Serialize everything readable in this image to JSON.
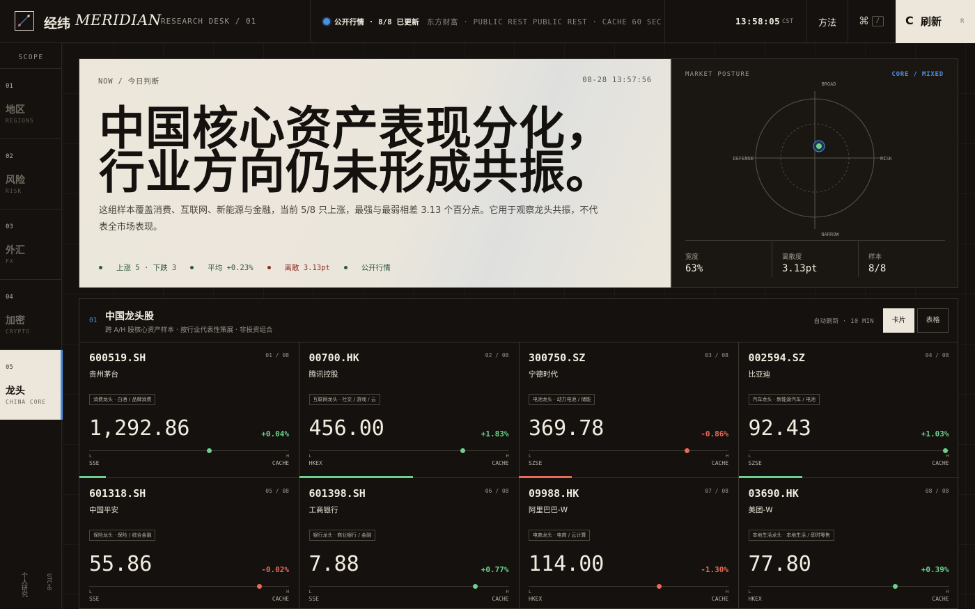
{
  "header": {
    "logo_cn": "经纬",
    "logo_en": "MERIDIAN",
    "desk": "RESEARCH DESK / 01",
    "status": "公开行情 · 8/8 已更新",
    "source": "东方财富 · PUBLIC REST  PUBLIC REST · CACHE 60 SEC",
    "clock": "13:58:05",
    "timezone": "CST",
    "method_label": "方法",
    "cmd_symbol": "⌘",
    "cmd_key": "/",
    "refresh_icon": "C",
    "refresh_label": "刷新",
    "refresh_key": "R"
  },
  "sidebar": {
    "scope": "SCOPE",
    "items": [
      {
        "num": "01",
        "cn": "地区",
        "en": "REGIONS",
        "active": false
      },
      {
        "num": "02",
        "cn": "风险",
        "en": "RISK",
        "active": false
      },
      {
        "num": "03",
        "cn": "外汇",
        "en": "FX",
        "active": false
      },
      {
        "num": "04",
        "cn": "加密",
        "en": "CRYPTO",
        "active": false
      },
      {
        "num": "05",
        "cn": "龙头",
        "en": "CHINA CORE",
        "active": true
      }
    ],
    "footer_left": "个人研究",
    "footer_right": "UTC+8"
  },
  "hero": {
    "now_label": "NOW / 今日判断",
    "timestamp": "08-28 13:57:56",
    "headline_line1": "中国核心资产表现分化，",
    "headline_line2": "行业方向仍未形成共振。",
    "subtitle": "这组样本覆盖消费、互联网、新能源与金融，当前 5/8 只上涨，最强与最弱相差 3.13 个百分点。它用于观察龙头共振，不代表全市场表现。",
    "tags": [
      {
        "text": "上涨 5 · 下跌 3",
        "tone": "green"
      },
      {
        "text": "平均 +0.23%",
        "tone": "green"
      },
      {
        "text": "离散 3.13pt",
        "tone": "red"
      },
      {
        "text": "公开行情",
        "tone": "green"
      }
    ]
  },
  "posture": {
    "title": "MARKET POSTURE",
    "mode": "CORE / MIXED",
    "axis_top": "BROAD",
    "axis_bottom": "NARROW",
    "axis_left": "DEFENSE",
    "axis_right": "RISK",
    "point": {
      "risk": 0.07,
      "broad": 0.2
    },
    "accent": "#4a8fe0",
    "point_color": "#6ed08a",
    "stats": [
      {
        "label": "宽度",
        "value": "63%"
      },
      {
        "label": "离散度",
        "value": "3.13pt"
      },
      {
        "label": "样本",
        "value": "8/8"
      }
    ]
  },
  "section": {
    "num": "01",
    "title": "中国龙头股",
    "subtitle": "跨 A/H 股核心资产样本 · 按行业代表性策展 · 非投资组合",
    "auto_refresh": "自动刷新 · 10 MIN",
    "view_card": "卡片",
    "view_table": "表格"
  },
  "stocks": [
    {
      "code": "600519.SH",
      "idx": "01 / 08",
      "name": "贵州茅台",
      "tags": "消费龙头 · 白酒 / 品牌消费",
      "price": "1,292.86",
      "change": "+0.04%",
      "dir": "up",
      "range": 0.6,
      "exchange": "SSE",
      "cache": "CACHE",
      "low": "L",
      "high": "H",
      "bar": 0.12
    },
    {
      "code": "00700.HK",
      "idx": "02 / 08",
      "name": "腾讯控股",
      "tags": "互联网龙头 · 社交 / 游戏 / 云",
      "price": "456.00",
      "change": "+1.83%",
      "dir": "up",
      "range": 0.77,
      "exchange": "HKEX",
      "cache": "CACHE",
      "low": "L",
      "high": "H",
      "bar": 0.52
    },
    {
      "code": "300750.SZ",
      "idx": "03 / 08",
      "name": "宁德时代",
      "tags": "电池龙头 · 动力电池 / 储能",
      "price": "369.78",
      "change": "-0.86%",
      "dir": "down",
      "range": 0.79,
      "exchange": "SZSE",
      "cache": "CACHE",
      "low": "L",
      "high": "H",
      "bar": 0.24
    },
    {
      "code": "002594.SZ",
      "idx": "04 / 08",
      "name": "比亚迪",
      "tags": "汽车龙头 · 新能源汽车 / 电池",
      "price": "92.43",
      "change": "+1.03%",
      "dir": "up",
      "range": 0.98,
      "exchange": "SZSE",
      "cache": "CACHE",
      "low": "L",
      "high": "H",
      "bar": 0.29
    },
    {
      "code": "601318.SH",
      "idx": "05 / 08",
      "name": "中国平安",
      "tags": "保险龙头 · 保险 / 综合金融",
      "price": "55.86",
      "change": "-0.02%",
      "dir": "down",
      "range": 0.85,
      "exchange": "SSE",
      "cache": "CACHE",
      "low": "L",
      "high": "H",
      "bar": 0
    },
    {
      "code": "601398.SH",
      "idx": "06 / 08",
      "name": "工商银行",
      "tags": "银行龙头 · 商业银行 / 金融",
      "price": "7.88",
      "change": "+0.77%",
      "dir": "up",
      "range": 0.83,
      "exchange": "SSE",
      "cache": "CACHE",
      "low": "L",
      "high": "H",
      "bar": 0
    },
    {
      "code": "09988.HK",
      "idx": "07 / 08",
      "name": "阿里巴巴-W",
      "tags": "电商龙头 · 电商 / 云计算",
      "price": "114.00",
      "change": "-1.30%",
      "dir": "down",
      "range": 0.65,
      "exchange": "HKEX",
      "cache": "CACHE",
      "low": "L",
      "high": "H",
      "bar": 0
    },
    {
      "code": "03690.HK",
      "idx": "08 / 08",
      "name": "美团-W",
      "tags": "本地生活龙头 · 本地生活 / 即时零售",
      "price": "77.80",
      "change": "+0.39%",
      "dir": "up",
      "range": 0.73,
      "exchange": "HKEX",
      "cache": "CACHE",
      "low": "L",
      "high": "H",
      "bar": 0
    }
  ]
}
